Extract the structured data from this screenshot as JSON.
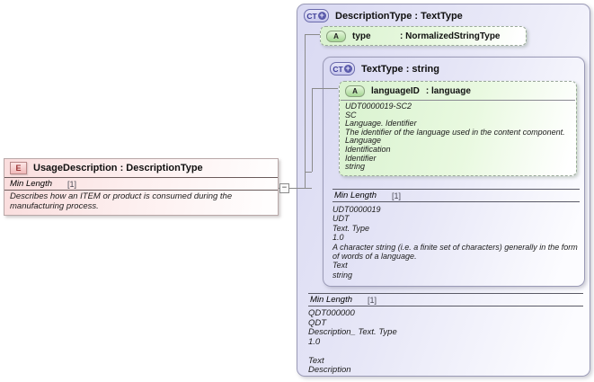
{
  "glyphs": {
    "plus": "+",
    "minus": "−"
  },
  "colors": {
    "element_fill": "#fadddd",
    "complextype_fill": "#d9d9f2",
    "attribute_fill": "#d9f2cf",
    "ct_icon_accent": "#5b5bab",
    "element_icon_accent": "#993333"
  },
  "element": {
    "icon": "E",
    "title": "UsageDescription : DescriptionType",
    "facet": {
      "label": "Min Length",
      "cardinality": "[1]"
    },
    "documentation": "Describes how an ITEM or product is consumed during the manufacturing process."
  },
  "description_type": {
    "icon": "CT",
    "title": "DescriptionType : TextType",
    "attribute_type": {
      "icon": "A",
      "name": "type",
      "type_label": ": NormalizedStringType"
    },
    "text_type": {
      "icon": "CT",
      "title": "TextType : string",
      "attribute_language": {
        "icon": "A",
        "name": "languageID",
        "type_label": ": language",
        "documentation": "UDT0000019-SC2\nSC\nLanguage. Identifier\nThe identifier of the language used in the content component.\nLanguage\nIdentification\nIdentifier\nstring"
      },
      "facet": {
        "label": "Min Length",
        "cardinality": "[1]"
      },
      "documentation": "UDT0000019\nUDT\nText. Type\n1.0\nA character string (i.e. a finite set of characters) generally in the form of words of a language.\nText\nstring"
    },
    "facet": {
      "label": "Min Length",
      "cardinality": "[1]"
    },
    "documentation": "QDT000000\nQDT\nDescription_ Text. Type\n1.0\n\nText\nDescription"
  }
}
